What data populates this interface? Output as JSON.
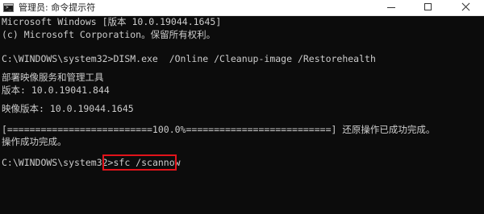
{
  "window": {
    "title": "管理员: 命令提示符",
    "app_icon": "cmd-icon",
    "controls": {
      "minimize_icon": "minimize-icon",
      "maximize_icon": "maximize-icon",
      "close_icon": "close-icon"
    }
  },
  "console": {
    "lines": [
      "Microsoft Windows [版本 10.0.19044.1645]",
      "(c) Microsoft Corporation。保留所有权利。",
      "C:\\WINDOWS\\system32>DISM.exe  /Online /Cleanup-image /Restorehealth",
      "部署映像服务和管理工具",
      "版本: 10.0.19041.844",
      "映像版本: 10.0.19044.1645",
      "[==========================100.0%==========================] 还原操作已成功完成。",
      "操作成功完成。"
    ],
    "prompt": "C:\\WINDOWS\\system32>",
    "current_command": "sfc /scannow",
    "highlight_color": "#e2131a",
    "text_color": "#cccccc",
    "background_color": "#0c0c0c"
  }
}
